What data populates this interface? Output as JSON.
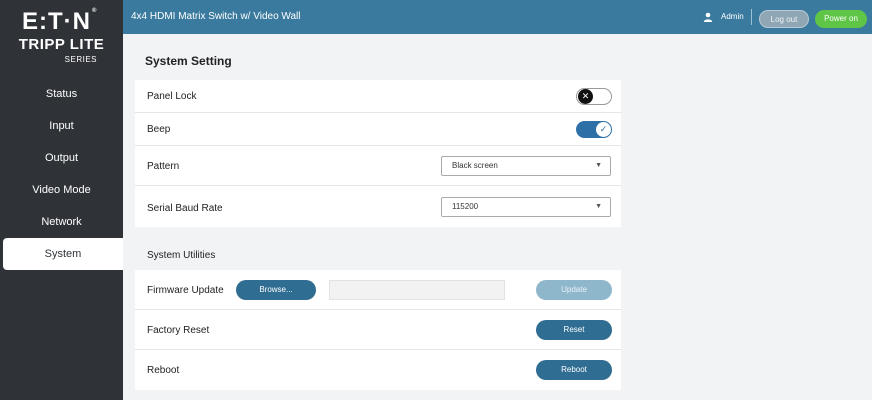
{
  "brand": {
    "name": "E:T·N",
    "reg": "®",
    "line2": "TRIPP LITE",
    "line3": "SERIES"
  },
  "header": {
    "title": "4x4 HDMI Matrix Switch w/ Video Wall",
    "user": "Admin",
    "logout_label": "Log out",
    "power_label": "Power on"
  },
  "sidebar": {
    "items": [
      {
        "label": "Status"
      },
      {
        "label": "Input"
      },
      {
        "label": "Output"
      },
      {
        "label": "Video Mode"
      },
      {
        "label": "Network"
      },
      {
        "label": "System",
        "active": true
      }
    ]
  },
  "main": {
    "title": "System Setting",
    "settings": {
      "panel_lock": {
        "label": "Panel Lock",
        "state": "off",
        "glyph": "✕"
      },
      "beep": {
        "label": "Beep",
        "state": "on",
        "glyph": "✓"
      },
      "pattern": {
        "label": "Pattern",
        "value": "Black screen"
      },
      "baud": {
        "label": "Serial Baud Rate",
        "value": "115200"
      }
    },
    "utilities_title": "System Utilities",
    "utilities": {
      "firmware": {
        "label": "Firmware Update",
        "browse_label": "Browse...",
        "file_value": "",
        "update_label": "Update"
      },
      "factory_reset": {
        "label": "Factory Reset",
        "button_label": "Reset"
      },
      "reboot": {
        "label": "Reboot",
        "button_label": "Reboot"
      }
    }
  },
  "colors": {
    "topbar": "#3a7a9f",
    "sidebar": "#2f3338",
    "accent_button": "#2f6d92",
    "power_green": "#5fc547",
    "toggle_on": "#2e6fa8"
  }
}
